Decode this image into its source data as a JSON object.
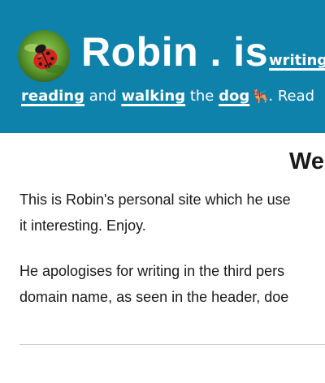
{
  "header": {
    "avatar_icon": "ladybird-avatar-icon",
    "site_title": "Robin . is",
    "first_link": "writing",
    "tagline": {
      "link_reading": "reading",
      "text_and": " and ",
      "link_walking": "walking",
      "text_the": " the ",
      "link_dog": "dog",
      "dog_emoji": "🐕‍🦺",
      "text_read": ". Read"
    },
    "colors": {
      "background": "#0f82ab",
      "text": "#ffffff"
    }
  },
  "main": {
    "heading": "We",
    "paragraph1": {
      "line1": "This is Robin's personal site which he use",
      "line2": "it interesting. Enjoy."
    },
    "paragraph2": {
      "line1": "He apologises for writing in the third pers",
      "line2": "domain name, as seen in the header, doe"
    }
  }
}
